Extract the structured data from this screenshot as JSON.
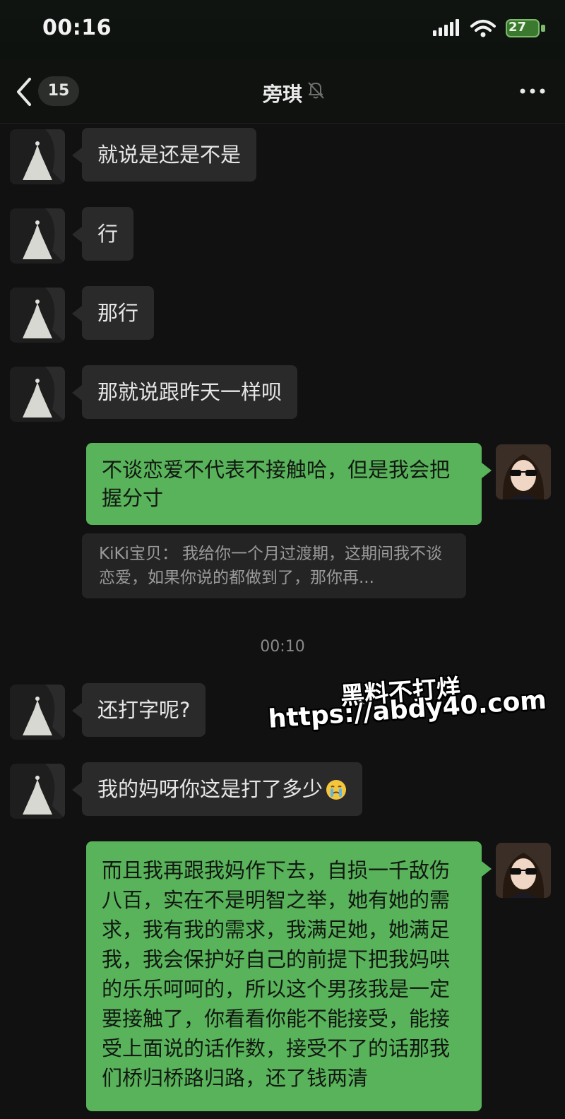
{
  "status_bar": {
    "time": "00:16",
    "battery": "27",
    "icons": [
      "signal-icon",
      "wifi-icon",
      "battery-icon"
    ]
  },
  "nav": {
    "back_icon": "chevron-left-icon",
    "unread_count": "15",
    "contact_name": "旁琪",
    "mute_icon": "bell-slash-icon",
    "more_icon": "more-dots-icon"
  },
  "messages": [
    {
      "side": "received",
      "text": "就说是还是不是"
    },
    {
      "side": "received",
      "text": "行"
    },
    {
      "side": "received",
      "text": "那行"
    },
    {
      "side": "received",
      "text": "那就说跟昨天一样呗"
    },
    {
      "side": "sent",
      "text": "不谈恋爱不代表不接触哈，但是我会把握分寸"
    },
    {
      "side": "sent",
      "quote": {
        "sender": "KiKi宝贝",
        "text": "我给你一个月过渡期，这期间我不谈恋爱，如果你说的都做到了，那你再..."
      }
    },
    {
      "timestamp": "00:10"
    },
    {
      "side": "received",
      "text": "还打字呢?"
    },
    {
      "side": "received",
      "text": "我的妈呀你这是打了多少",
      "emoji": "crying-face-emoji"
    },
    {
      "side": "sent",
      "text": "而且我再跟我妈作下去，自损一千敌伤八百，实在不是明智之举，她有她的需求，我有我的需求，我满足她，她满足我，我会保护好自己的前提下把我妈哄的乐乐呵呵的，所以这个男孩我是一定要接触了，你看看你能不能接受，能接受上面说的话作数，接受不了的话那我们桥归桥路归路，还了钱两清"
    }
  ],
  "watermark": {
    "line1": "黑料不打烊",
    "line2": "https://abdy40.com"
  },
  "colors": {
    "background": "#111111",
    "received_bubble": "#2a2a2a",
    "sent_bubble": "#58b35a",
    "battery": "#3b7a2e"
  }
}
